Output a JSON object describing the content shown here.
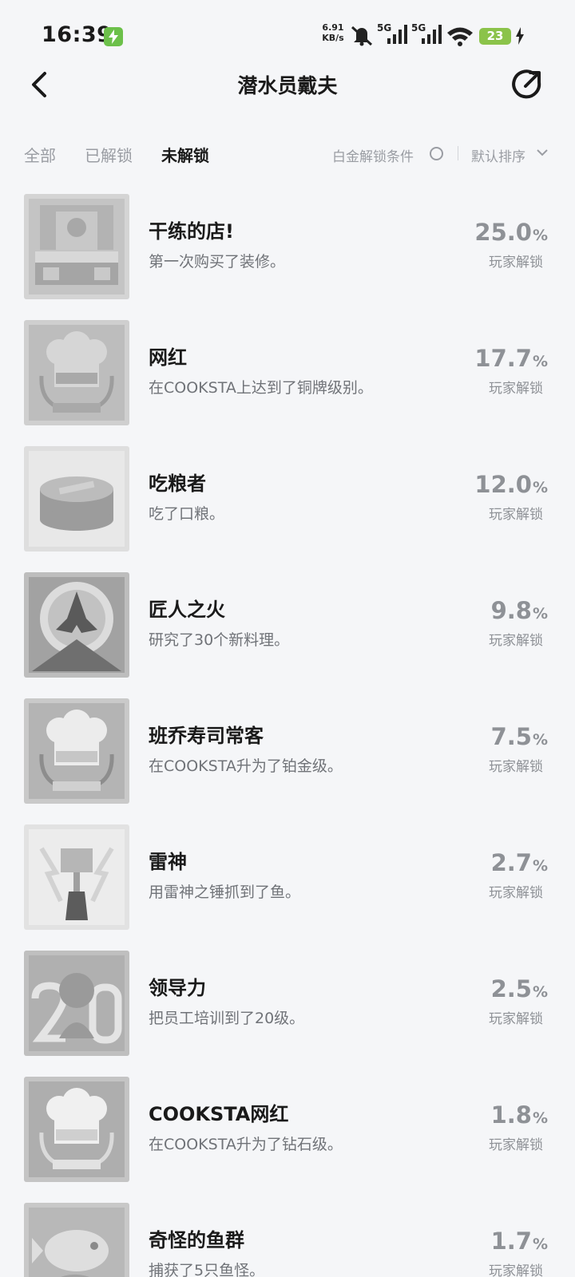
{
  "status_bar": {
    "time": "16:39",
    "net_speed_value": "6.91",
    "net_speed_unit": "KB/s",
    "sim1": "5G",
    "sim2": "5G",
    "battery": "23"
  },
  "header": {
    "title": "潜水员戴夫"
  },
  "filters": {
    "tabs": [
      {
        "label": "全部"
      },
      {
        "label": "已解锁"
      },
      {
        "label": "未解锁"
      }
    ],
    "active_tab": "未解锁",
    "platinum_condition": "白金解锁条件",
    "sort": "默认排序"
  },
  "achievements": [
    {
      "title": "干练的店!",
      "desc": "第一次购买了装修。",
      "pct": "25.0",
      "unlock_label": "玩家解锁"
    },
    {
      "title": "网红",
      "desc": "在COOKSTA上达到了铜牌级别。",
      "pct": "17.7",
      "unlock_label": "玩家解锁"
    },
    {
      "title": "吃粮者",
      "desc": "吃了口粮。",
      "pct": "12.0",
      "unlock_label": "玩家解锁"
    },
    {
      "title": "匠人之火",
      "desc": "研究了30个新料理。",
      "pct": "9.8",
      "unlock_label": "玩家解锁"
    },
    {
      "title": "班乔寿司常客",
      "desc": "在COOKSTA升为了铂金级。",
      "pct": "7.5",
      "unlock_label": "玩家解锁"
    },
    {
      "title": "雷神",
      "desc": "用雷神之锤抓到了鱼。",
      "pct": "2.7",
      "unlock_label": "玩家解锁"
    },
    {
      "title": "领导力",
      "desc": "把员工培训到了20级。",
      "pct": "2.5",
      "unlock_label": "玩家解锁"
    },
    {
      "title": "COOKSTA网红",
      "desc": "在COOKSTA升为了钻石级。",
      "pct": "1.8",
      "unlock_label": "玩家解锁"
    },
    {
      "title": "奇怪的鱼群",
      "desc": "捕获了5只鱼怪。",
      "pct": "1.7",
      "unlock_label": "玩家解锁"
    }
  ],
  "percent_unit": "%",
  "icons": {
    "back": "back-arrow-icon",
    "share": "share-icon",
    "sort": "chevron-down-icon",
    "condition": "radio-circle-icon"
  }
}
